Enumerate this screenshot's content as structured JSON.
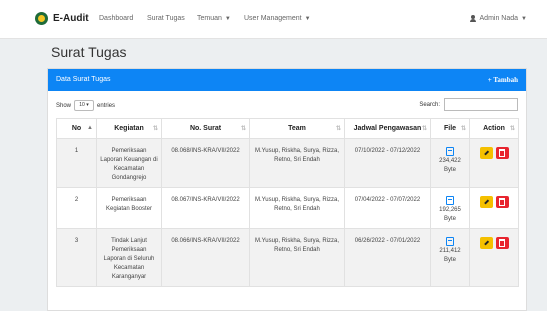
{
  "navbar": {
    "brand": "E-Audit",
    "items": [
      {
        "label": "Dashboard"
      },
      {
        "label": "Surat Tugas"
      },
      {
        "label": "Temuan",
        "dropdown": true
      },
      {
        "label": "User Management",
        "dropdown": true
      }
    ],
    "user": "Admin Nada"
  },
  "page": {
    "title": "Surat Tugas"
  },
  "card": {
    "title": "Data Surat Tugas",
    "add_button": "+ Tambah",
    "show_prefix": "Show",
    "show_value": "10",
    "show_suffix": "entries",
    "search_label": "Search:",
    "search_value": ""
  },
  "table": {
    "headers": [
      "No",
      "Kegiatan",
      "No. Surat",
      "Team",
      "Jadwal Pengawasan",
      "File",
      "Action"
    ],
    "rows": [
      {
        "no": "1",
        "kegiatan": "Pemeriksaan Laporan Keuangan di Kecamatan Gondangrejo",
        "no_surat": "08.068/INS-KRA/VII/2022",
        "team": "M.Yusup, Riskha, Surya, Rizza, Retno, Sri Endah",
        "jadwal": "07/10/2022 - 07/12/2022",
        "file_size": "234,422",
        "file_unit": "Byte"
      },
      {
        "no": "2",
        "kegiatan": "Pemeriksaan Kegiatan Booster",
        "no_surat": "08.067/INS-KRA/VII/2022",
        "team": "M.Yusup, Riskha, Surya, Rizza, Retno, Sri Endah",
        "jadwal": "07/04/2022 - 07/07/2022",
        "file_size": "192,265",
        "file_unit": "Byte"
      },
      {
        "no": "3",
        "kegiatan": "Tindak Lanjut Pemeriksaan Laporan di Seluruh Kecamatan Karanganyar",
        "no_surat": "08.066/INS-KRA/VII/2022",
        "team": "M.Yusup, Riskha, Surya, Rizza, Retno, Sri Endah",
        "jadwal": "06/26/2022 - 07/01/2022",
        "file_size": "211,412",
        "file_unit": "Byte"
      }
    ]
  },
  "colors": {
    "primary": "#0d85f5",
    "edit": "#f5c000",
    "delete": "#e8252f"
  },
  "icons": {
    "sort": "sort-arrows-icon",
    "sort_active": "sort-up-icon",
    "file": "file-icon",
    "edit": "pencil-icon",
    "delete": "trash-icon",
    "user": "user-icon"
  }
}
